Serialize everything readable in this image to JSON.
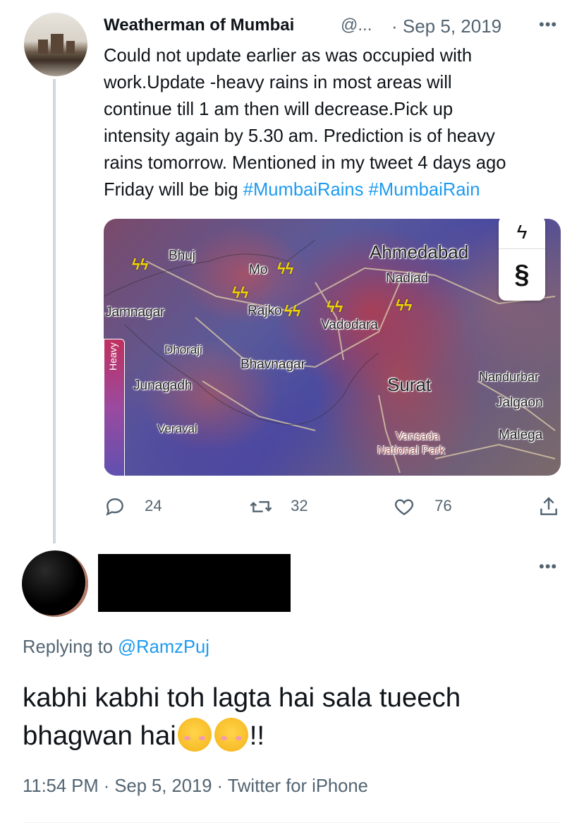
{
  "parent_tweet": {
    "author_name": "Weatherman of Mumbai",
    "handle": "@...",
    "date": "· Sep 5, 2019",
    "more_icon": "more-horizontal-icon",
    "text_line1": "Could not update earlier as was occupied with",
    "text_line2": "work.Update -heavy rains in most areas will",
    "text_line3": "continue till 1 am then will decrease.Pick up",
    "text_line4": "intensity again by 5.30 am. Prediction is of heavy",
    "text_line5": "rains tomorrow. Mentioned in my tweet 4 days ago",
    "text_line6_prefix": "Friday will be big ",
    "hashtag1": "#MumbaiRains",
    "hashtag2": "#MumbaiRain",
    "map": {
      "legend_label": "Heavy",
      "labels": {
        "bhuj": "Bhuj",
        "ahmedabad": "Ahmedabad",
        "nadiad": "Nadiad",
        "morbi": "Mo",
        "jamnagar": "Jamnagar",
        "rajkot": "Rajko",
        "vadodara": "Vadodara",
        "dhoraji": "Dhoraji",
        "bhavnagar": "Bhavnagar",
        "junagadh": "Junagadh",
        "surat": "Surat",
        "nandurbar": "Nandurbar",
        "jalgaon": "Jalgaon",
        "veraval": "Veraval",
        "vansada": "Vansada",
        "national_park": "National Park",
        "malegaon": "Malega"
      },
      "ctrl_lightning_icon": "lightning-icon",
      "ctrl_cyclone_icon": "cyclone-icon"
    },
    "actions": {
      "replies": "24",
      "retweets": "32",
      "likes": "76"
    }
  },
  "reply_tweet": {
    "replying_prefix": "Replying to ",
    "replying_handle": "@RamzPuj",
    "text_line1": "kabhi kabhi toh lagta hai sala tueech",
    "text_line2_prefix": "bhagwan hai",
    "text_line2_suffix": "!!",
    "emoji_name": "smiling-face-with-smiling-eyes",
    "meta": "11:54 PM · Sep 5, 2019 · Twitter for iPhone"
  },
  "colors": {
    "link": "#1d9bf0",
    "secondary_text": "#536471",
    "primary_text": "#0f1419"
  }
}
